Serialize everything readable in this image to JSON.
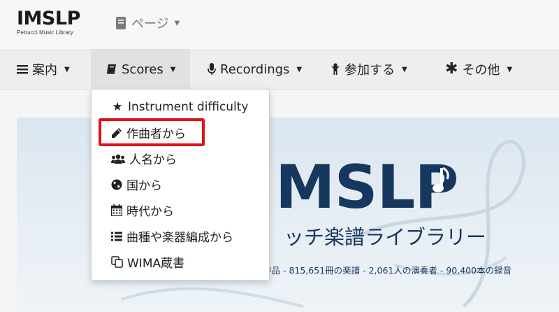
{
  "header": {
    "logo_text": "IMSLP",
    "logo_subtitle": "Petrucci Music Library",
    "page_menu_label": "ページ"
  },
  "navbar": {
    "items": [
      {
        "label": "案内",
        "icon": "list-icon"
      },
      {
        "label": "Scores",
        "icon": "book-icon",
        "active": true
      },
      {
        "label": "Recordings",
        "icon": "microphone-icon"
      },
      {
        "label": "参加する",
        "icon": "person-icon"
      },
      {
        "label": "その他",
        "icon": "asterisk-icon"
      }
    ]
  },
  "dropdown": {
    "items": [
      {
        "label": "Instrument difficulty",
        "icon": "star-icon"
      },
      {
        "label": "作曲者から",
        "icon": "pencil-icon",
        "highlighted": true
      },
      {
        "label": "人名から",
        "icon": "users-icon"
      },
      {
        "label": "国から",
        "icon": "globe-icon"
      },
      {
        "label": "時代から",
        "icon": "calendar-icon"
      },
      {
        "label": "曲種や楽器編成から",
        "icon": "list-icon"
      },
      {
        "label": "WIMA蔵書",
        "icon": "copy-icon"
      }
    ]
  },
  "banner": {
    "title": "MSLP",
    "subtitle": "ッチ楽譜ライブラリー",
    "stats": "作品 - 815,651冊の楽譜 - 2,061人の演奏者 - 90,400本の録音"
  },
  "colors": {
    "highlight": "#e3101b",
    "banner_text": "#16375e",
    "navbar_bg": "#eeeeee"
  }
}
